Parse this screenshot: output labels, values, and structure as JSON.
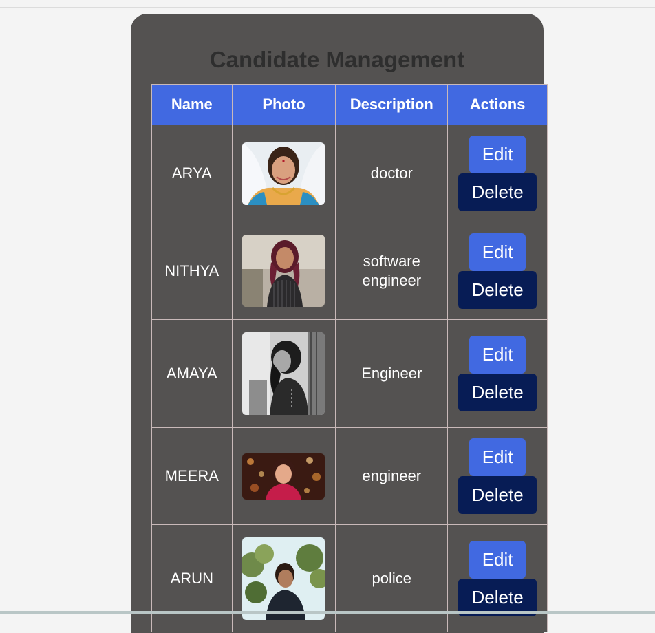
{
  "page": {
    "title": "Candidate Management"
  },
  "table": {
    "headers": {
      "name": "Name",
      "photo": "Photo",
      "description": "Description",
      "actions": "Actions"
    },
    "rows": [
      {
        "name": "ARYA",
        "description": "doctor",
        "edit": "Edit",
        "delete": "Delete"
      },
      {
        "name": "NITHYA",
        "description": "software engineer",
        "edit": "Edit",
        "delete": "Delete"
      },
      {
        "name": "AMAYA",
        "description": "Engineer",
        "edit": "Edit",
        "delete": "Delete"
      },
      {
        "name": "MEERA",
        "description": "engineer",
        "edit": "Edit",
        "delete": "Delete"
      },
      {
        "name": "ARUN",
        "description": "police",
        "edit": "Edit",
        "delete": "Delete"
      }
    ]
  },
  "colors": {
    "panel": "#545251",
    "header": "#4169e1",
    "edit_button": "#4169e1",
    "delete_button": "#071c55"
  }
}
